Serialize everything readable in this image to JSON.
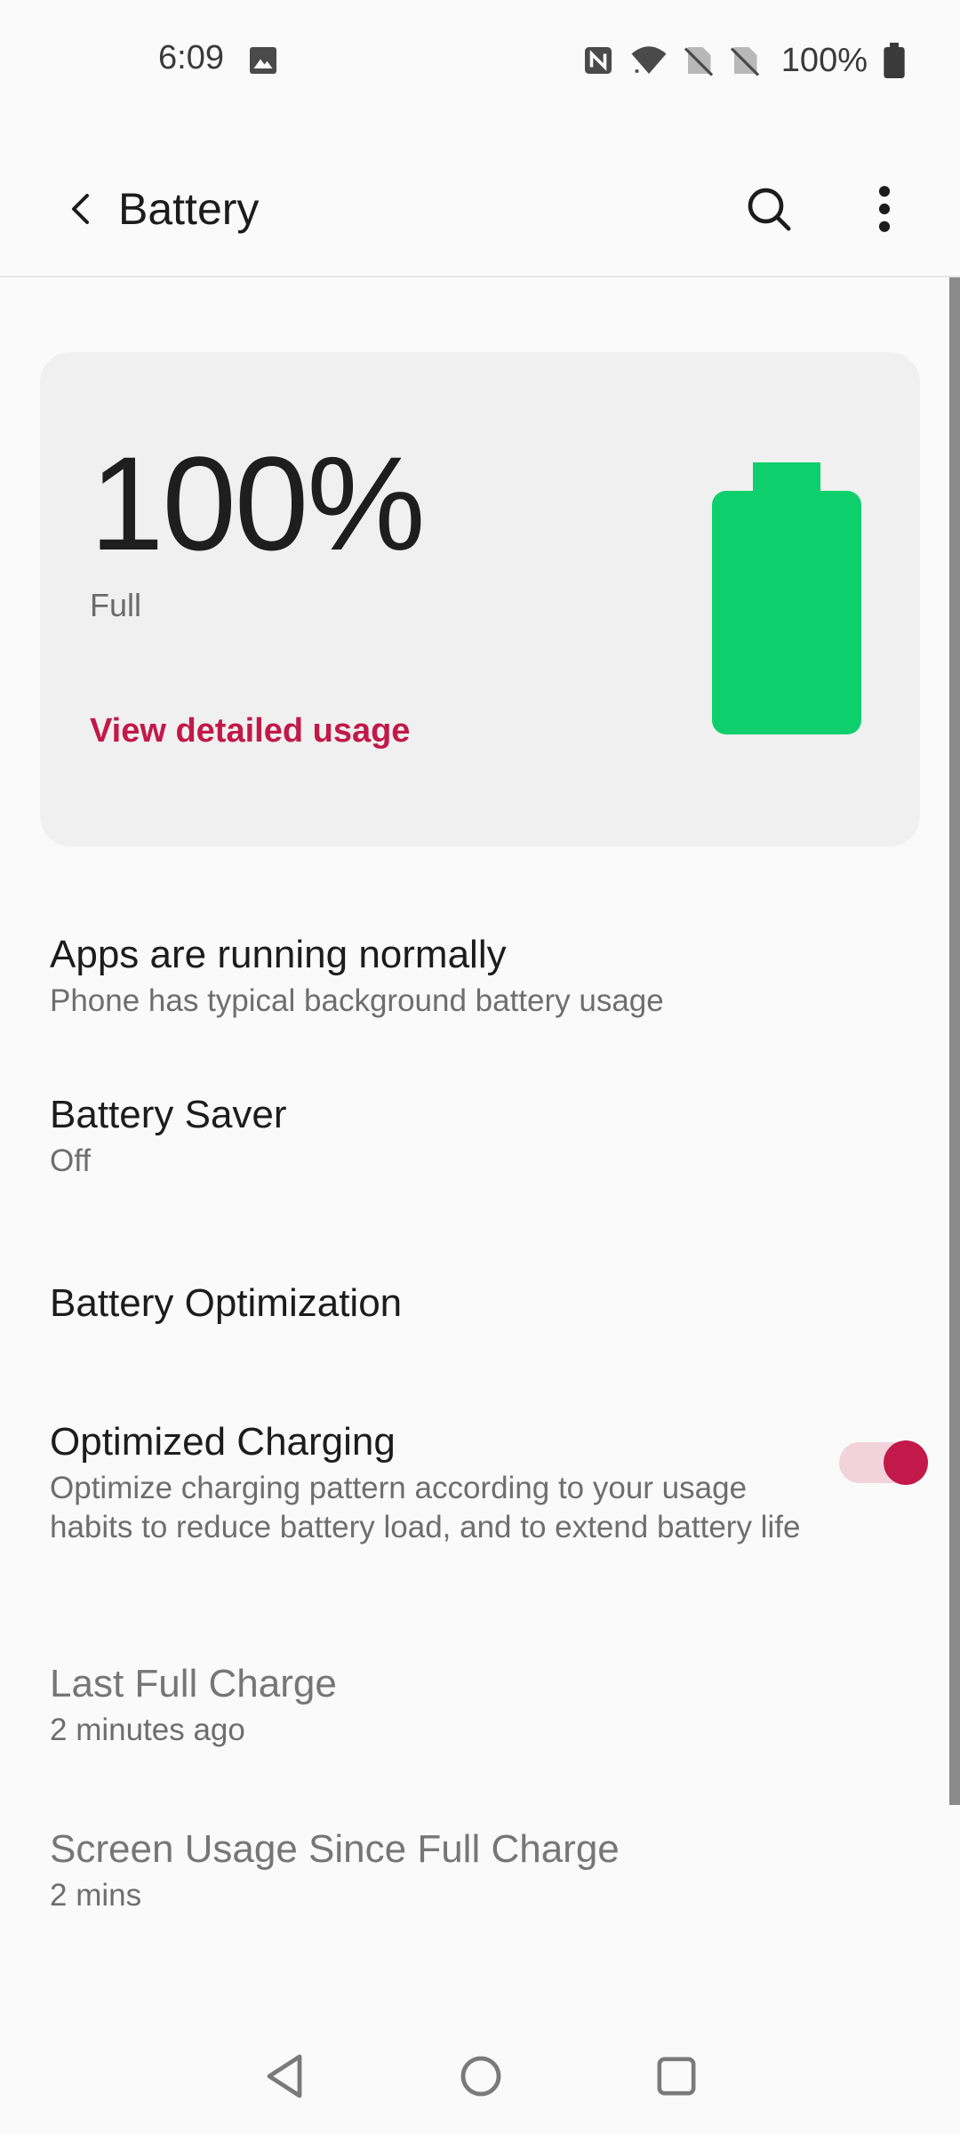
{
  "status_bar": {
    "time": "6:09",
    "battery_percent": "100%",
    "icons": [
      "gallery-icon",
      "nfc-icon",
      "wifi-icon",
      "no-sim-icon",
      "no-sim-icon",
      "battery-icon"
    ]
  },
  "toolbar": {
    "title": "Battery",
    "icons": [
      "back-arrow-icon",
      "search-icon",
      "more-vert-icon"
    ]
  },
  "battery_card": {
    "percent": "100%",
    "status": "Full",
    "link_label": "View detailed usage",
    "level": 1.0,
    "battery_color": "#0dd06c"
  },
  "list": {
    "apps_running": {
      "title": "Apps are running normally",
      "subtitle": "Phone has typical background battery usage"
    },
    "battery_saver": {
      "title": "Battery Saver",
      "subtitle": "Off"
    },
    "battery_optimization": {
      "title": "Battery Optimization"
    },
    "optimized_charging": {
      "title": "Optimized Charging",
      "subtitle": "Optimize charging pattern according to your usage habits to reduce battery load, and to extend battery life",
      "enabled": true
    },
    "last_full_charge": {
      "title": "Last Full Charge",
      "subtitle": "2 minutes ago"
    },
    "screen_usage": {
      "title": "Screen Usage Since Full Charge",
      "subtitle": "2 mins"
    }
  },
  "colors": {
    "accent": "#c2184a",
    "accent_light": "#f2d3dc",
    "battery_fill": "#0dd06c",
    "background": "#fafafa",
    "card": "#f0f0f0"
  },
  "nav_bar": {
    "icons": [
      "nav-back-icon",
      "nav-home-icon",
      "nav-recents-icon"
    ]
  }
}
